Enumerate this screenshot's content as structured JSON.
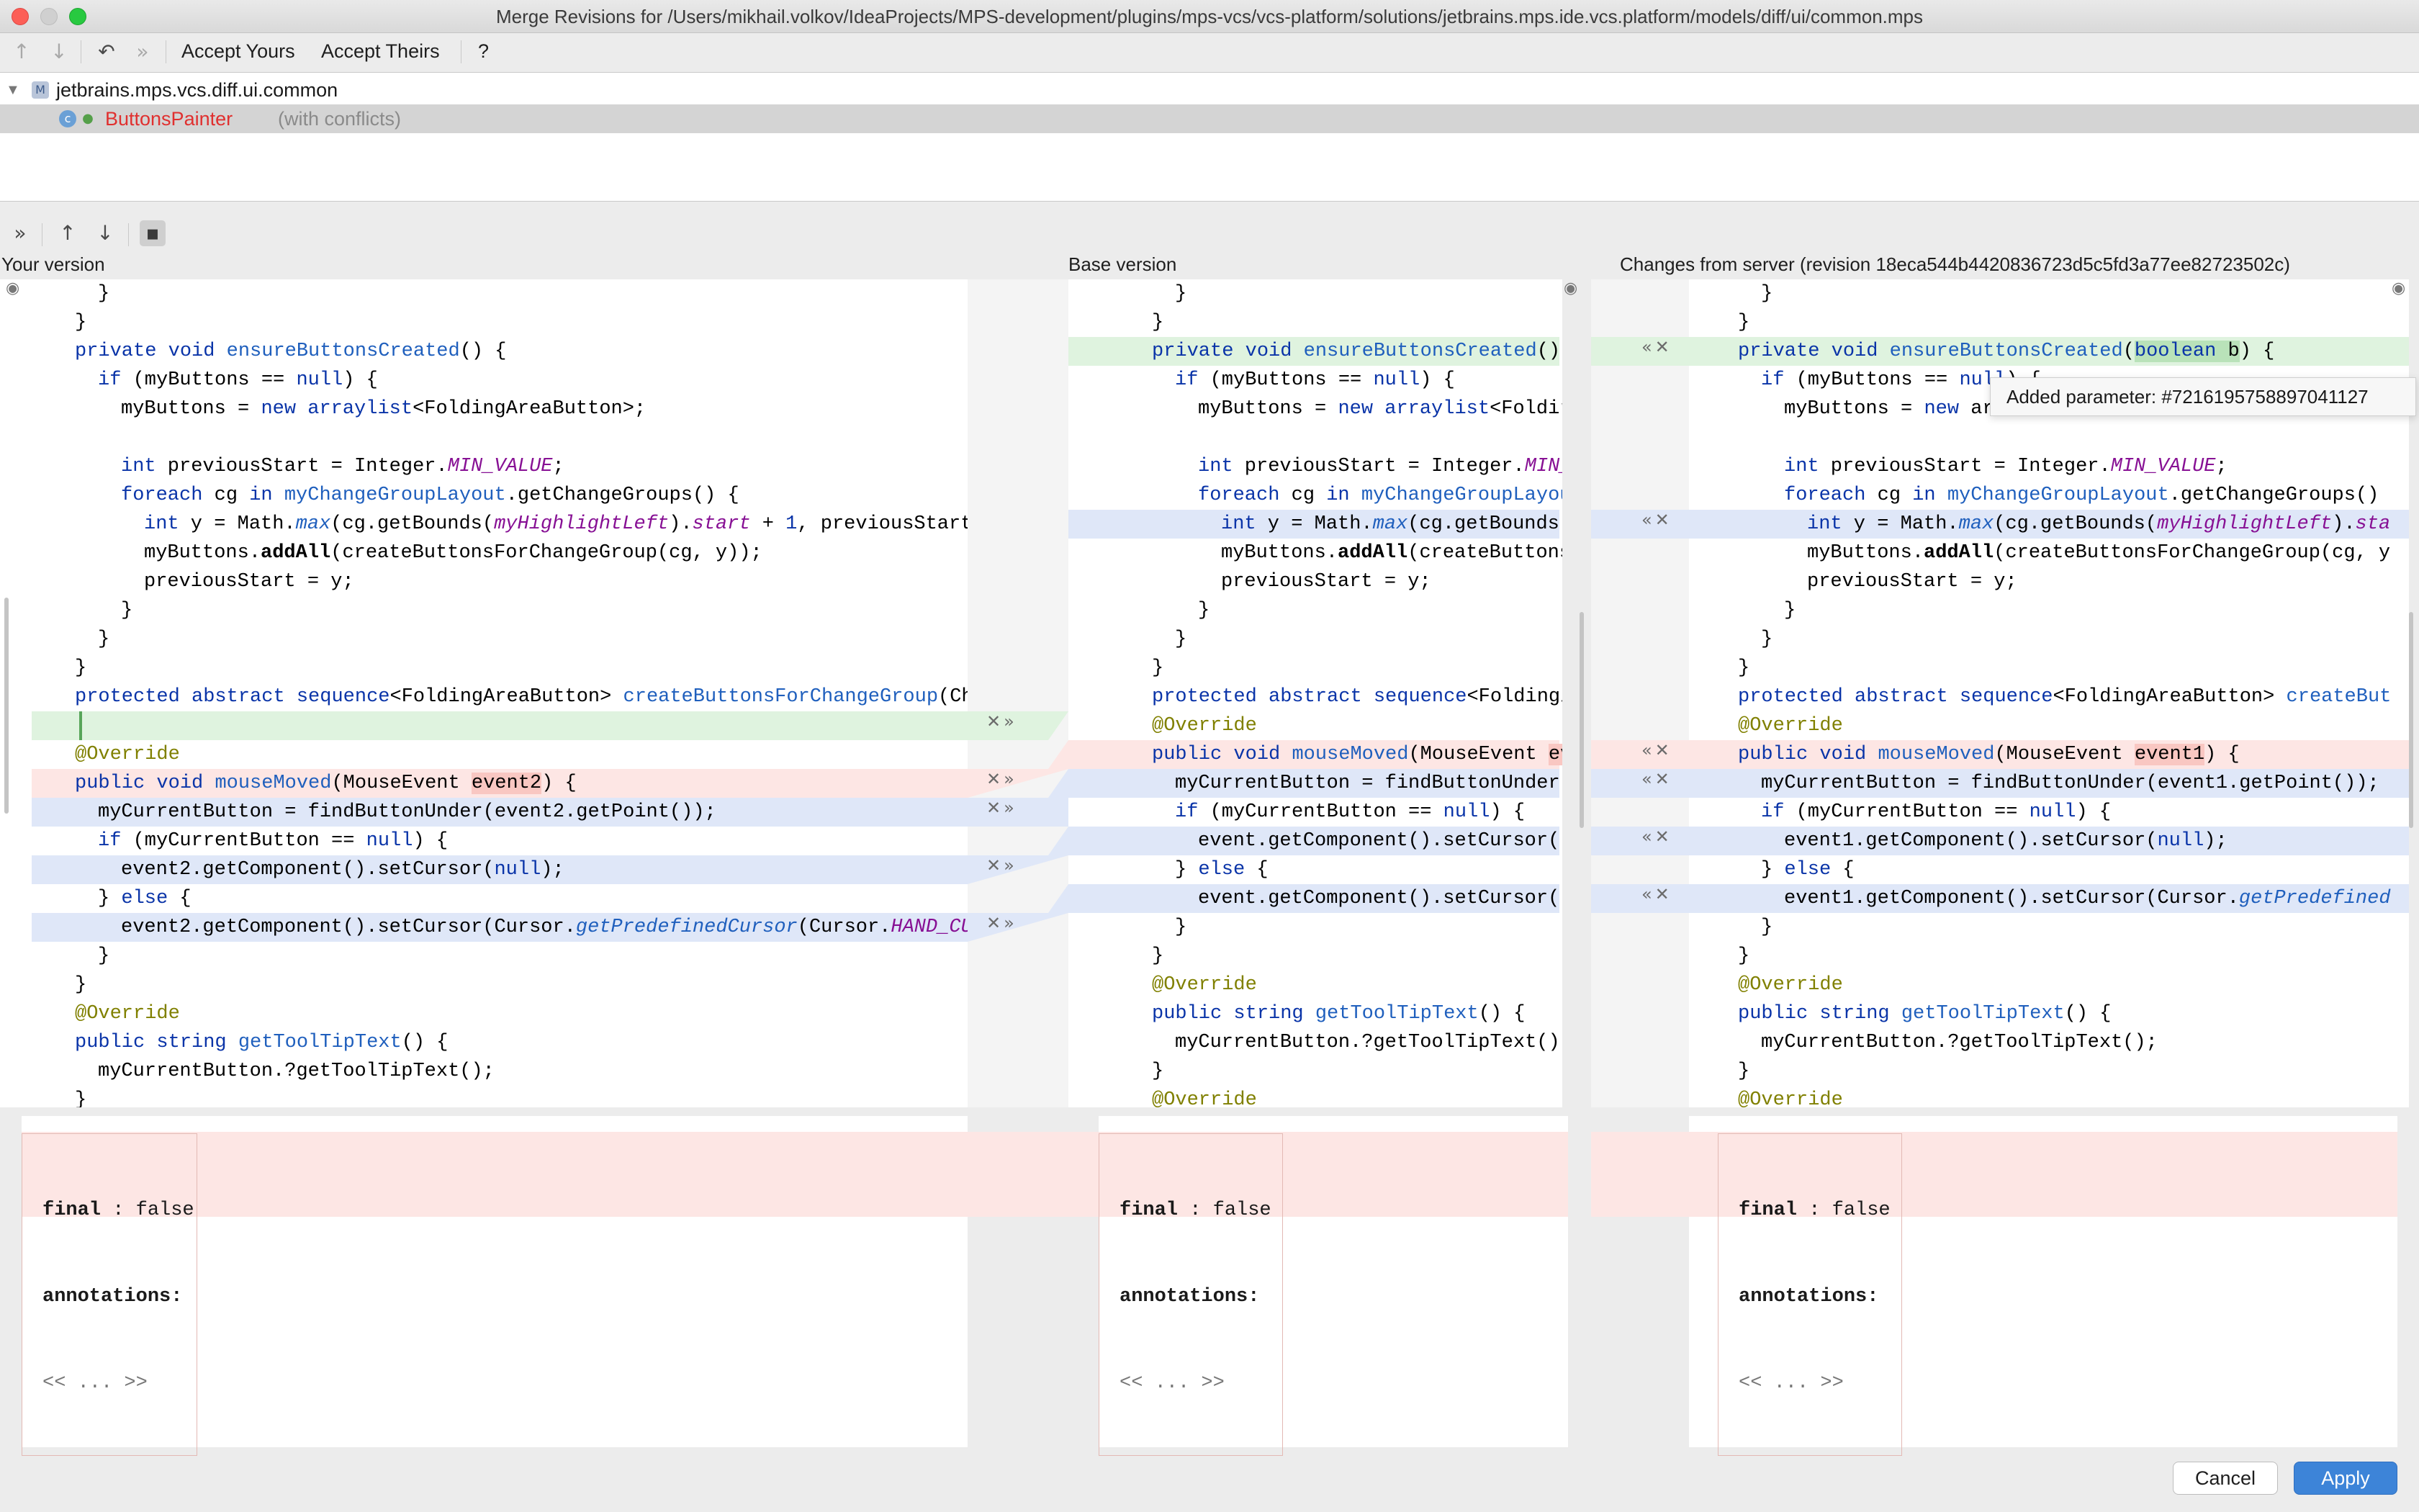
{
  "window": {
    "title": "Merge Revisions for /Users/mikhail.volkov/IdeaProjects/MPS-development/plugins/mps-vcs/vcs-platform/solutions/jetbrains.mps.ide.vcs.platform/models/diff/ui/common.mps"
  },
  "toolbar": {
    "accept_yours": "Accept Yours",
    "accept_theirs": "Accept Theirs",
    "help": "?"
  },
  "tree": {
    "module": "jetbrains.mps.vcs.diff.ui.common",
    "node_name": "ButtonsPainter",
    "node_note": "(with conflicts)"
  },
  "panes": {
    "yours_title": "Your version",
    "base_title": "Base version",
    "theirs_title": "Changes from server (revision 18eca544b4420836723d5c5fd3a77ee82723502c)"
  },
  "tooltip": {
    "text": "Added parameter: #7216195758897041127"
  },
  "properties": {
    "line1_key": "final",
    "line1_sep": " : ",
    "line1_val": "false",
    "line2": "annotations:",
    "line3": "<< ... >>"
  },
  "buttons": {
    "cancel": "Cancel",
    "apply": "Apply"
  },
  "colors": {
    "added": "#dff3df",
    "modified": "#dfe7f8",
    "conflict": "#fde6e4",
    "apply_button": "#3d84d8"
  }
}
